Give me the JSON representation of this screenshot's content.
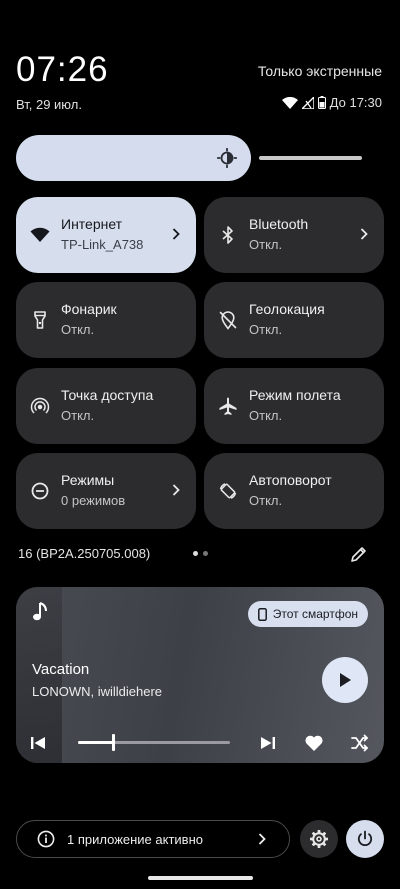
{
  "header": {
    "time": "07:26",
    "carrier": "Только экстренные",
    "date": "Вт, 29 июл.",
    "alarm": "До 17:30"
  },
  "brightness": {
    "level": 0.68
  },
  "tiles": [
    {
      "name": "Интернет",
      "sub": "TP-Link_A738",
      "icon": "wifi-icon",
      "active": true,
      "chevron": true
    },
    {
      "name": "Bluetooth",
      "sub": "Откл.",
      "icon": "bluetooth-icon",
      "active": false,
      "chevron": true
    },
    {
      "name": "Фонарик",
      "sub": "Откл.",
      "icon": "flashlight-icon",
      "active": false,
      "chevron": false
    },
    {
      "name": "Геолокация",
      "sub": "Откл.",
      "icon": "location-off-icon",
      "active": false,
      "chevron": false
    },
    {
      "name": "Точка доступа",
      "sub": "Откл.",
      "icon": "hotspot-icon",
      "active": false,
      "chevron": false
    },
    {
      "name": "Режим полета",
      "sub": "Откл.",
      "icon": "airplane-icon",
      "active": false,
      "chevron": false
    },
    {
      "name": "Режимы",
      "sub": "0 режимов",
      "icon": "modes-icon",
      "active": false,
      "chevron": true
    },
    {
      "name": "Автоповорот",
      "sub": "Откл.",
      "icon": "auto-rotate-icon",
      "active": false,
      "chevron": false
    }
  ],
  "footer": {
    "build": "16 (BP2A.250705.008)",
    "page": 1,
    "pages": 2
  },
  "media": {
    "device": "Этот смартфон",
    "title": "Vacation",
    "artist": "LONOWN, iwilldiehere",
    "progress": 0.23
  },
  "bottom": {
    "active_apps": "1 приложение активно"
  },
  "colors": {
    "accent": "#d6deee",
    "tile_bg": "#2c2c2e",
    "background": "#000000"
  }
}
